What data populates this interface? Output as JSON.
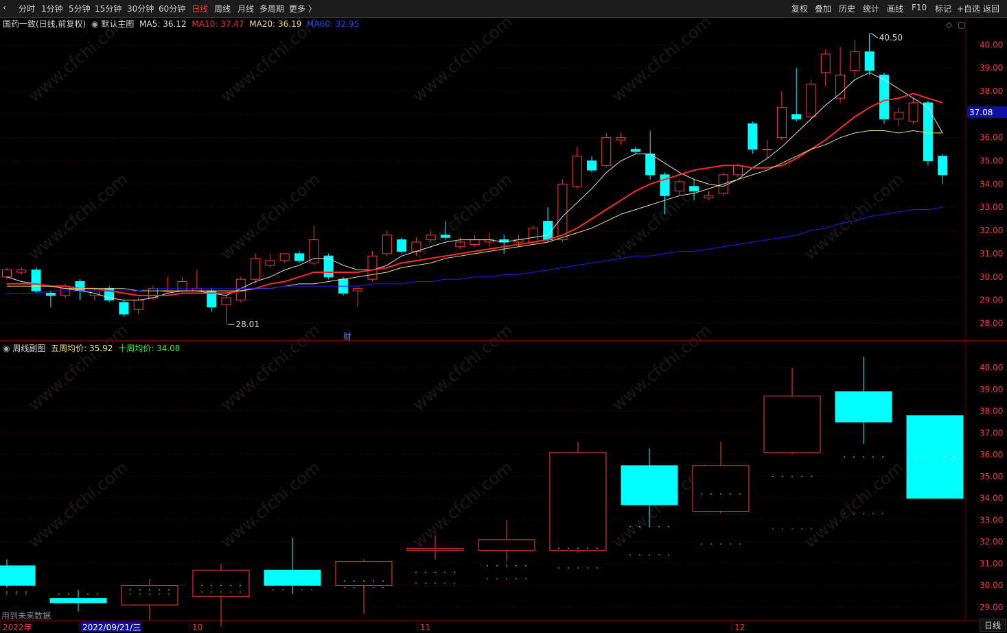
{
  "toolbar": {
    "period_tabs": [
      "分时",
      "1分钟",
      "5分钟",
      "15分钟",
      "30分钟",
      "60分钟",
      "日线",
      "周线",
      "月线",
      "多周期",
      "更多 〉"
    ],
    "active_tab": "日线",
    "right_buttons": [
      "复权",
      "叠加",
      "历史",
      "统计",
      "画线",
      "F10",
      "标记",
      "+自选",
      "返回"
    ]
  },
  "main_panel": {
    "stock": "国药一致(日线,前复权)",
    "template": "默认主图",
    "ma5_label": "MA5: 36.12",
    "ma10_label": "MA10: 37.47",
    "ma20_label": "MA20: 36.19",
    "ma60_label": "MA60: 32.95",
    "high_marker": "40.50",
    "low_marker": "28.01",
    "last_price_badge": "37.08",
    "finance_marker": "财",
    "colors": {
      "ma5": "#e0e0e0",
      "ma10": "#ff2a2a",
      "ma20": "#e8e07a",
      "ma60": "#2a2aff",
      "up": "#ff3a3a",
      "down": "#00ffff"
    }
  },
  "sub_panel": {
    "title": "周线副图",
    "ma5w_label": "五周均价: 35.92",
    "ma10w_label": "十周均价: 34.08",
    "footnote": "用到未来数据"
  },
  "x_axis": {
    "labels": [
      "2022年",
      "2022/09/21/三",
      "10",
      "11",
      "12"
    ]
  },
  "period_indicator": "日线",
  "chart_data": [
    {
      "type": "candlestick",
      "title": "国药一致(日线,前复权)",
      "ylim": [
        27.6,
        40.6
      ],
      "yticks": [
        28.0,
        29.0,
        30.0,
        31.0,
        32.0,
        33.0,
        34.0,
        35.0,
        36.0,
        37.0,
        38.0,
        39.0,
        40.0
      ],
      "candles": [
        {
          "o": 30.0,
          "c": 30.3,
          "h": 30.4,
          "l": 29.9
        },
        {
          "o": 30.2,
          "c": 30.3,
          "h": 30.4,
          "l": 30.1
        },
        {
          "o": 30.3,
          "c": 29.4,
          "h": 30.4,
          "l": 29.3
        },
        {
          "o": 29.3,
          "c": 29.2,
          "h": 29.4,
          "l": 28.7
        },
        {
          "o": 29.2,
          "c": 29.6,
          "h": 29.7,
          "l": 29.1
        },
        {
          "o": 29.8,
          "c": 29.4,
          "h": 29.9,
          "l": 29.0
        },
        {
          "o": 29.2,
          "c": 29.4,
          "h": 29.5,
          "l": 29.0
        },
        {
          "o": 29.5,
          "c": 29.0,
          "h": 29.6,
          "l": 28.9
        },
        {
          "o": 28.9,
          "c": 28.4,
          "h": 29.0,
          "l": 28.3
        },
        {
          "o": 28.6,
          "c": 29.0,
          "h": 29.1,
          "l": 28.4
        },
        {
          "o": 29.1,
          "c": 29.5,
          "h": 29.6,
          "l": 29.0
        },
        {
          "o": 29.4,
          "c": 29.4,
          "h": 30.0,
          "l": 29.3
        },
        {
          "o": 29.4,
          "c": 29.8,
          "h": 30.0,
          "l": 29.3
        },
        {
          "o": 29.4,
          "c": 29.5,
          "h": 30.3,
          "l": 29.4
        },
        {
          "o": 29.4,
          "c": 28.7,
          "h": 29.5,
          "l": 28.5
        },
        {
          "o": 28.8,
          "c": 29.1,
          "h": 29.2,
          "l": 28.0
        },
        {
          "o": 29.0,
          "c": 29.9,
          "h": 30.0,
          "l": 28.9
        },
        {
          "o": 29.9,
          "c": 30.8,
          "h": 31.0,
          "l": 29.7
        },
        {
          "o": 30.5,
          "c": 30.7,
          "h": 31.0,
          "l": 30.4
        },
        {
          "o": 30.7,
          "c": 31.0,
          "h": 31.0,
          "l": 30.6
        },
        {
          "o": 31.0,
          "c": 30.7,
          "h": 31.1,
          "l": 30.6
        },
        {
          "o": 30.6,
          "c": 31.6,
          "h": 32.2,
          "l": 30.5
        },
        {
          "o": 30.9,
          "c": 30.0,
          "h": 31.0,
          "l": 29.9
        },
        {
          "o": 29.9,
          "c": 29.3,
          "h": 30.0,
          "l": 29.2
        },
        {
          "o": 29.4,
          "c": 29.5,
          "h": 29.6,
          "l": 28.7
        },
        {
          "o": 29.9,
          "c": 30.9,
          "h": 31.1,
          "l": 29.8
        },
        {
          "o": 31.0,
          "c": 31.8,
          "h": 32.0,
          "l": 30.9
        },
        {
          "o": 31.6,
          "c": 31.1,
          "h": 31.7,
          "l": 31.0
        },
        {
          "o": 31.1,
          "c": 31.5,
          "h": 31.7,
          "l": 30.9
        },
        {
          "o": 31.6,
          "c": 31.8,
          "h": 32.0,
          "l": 31.5
        },
        {
          "o": 31.8,
          "c": 31.7,
          "h": 32.4,
          "l": 31.6
        },
        {
          "o": 31.3,
          "c": 31.5,
          "h": 31.7,
          "l": 31.2
        },
        {
          "o": 31.4,
          "c": 31.6,
          "h": 31.8,
          "l": 31.3
        },
        {
          "o": 31.5,
          "c": 31.6,
          "h": 31.9,
          "l": 31.3
        },
        {
          "o": 31.6,
          "c": 31.5,
          "h": 31.8,
          "l": 31.0
        },
        {
          "o": 31.5,
          "c": 31.6,
          "h": 31.8,
          "l": 31.3
        },
        {
          "o": 31.5,
          "c": 32.1,
          "h": 32.2,
          "l": 31.4
        },
        {
          "o": 32.4,
          "c": 31.6,
          "h": 33.0,
          "l": 31.5
        },
        {
          "o": 31.6,
          "c": 34.0,
          "h": 34.2,
          "l": 31.5
        },
        {
          "o": 33.9,
          "c": 35.2,
          "h": 35.6,
          "l": 33.8
        },
        {
          "o": 35.0,
          "c": 34.6,
          "h": 35.2,
          "l": 34.5
        },
        {
          "o": 34.8,
          "c": 36.0,
          "h": 36.2,
          "l": 34.7
        },
        {
          "o": 35.9,
          "c": 36.0,
          "h": 36.2,
          "l": 35.7
        },
        {
          "o": 35.5,
          "c": 35.4,
          "h": 35.6,
          "l": 35.3
        },
        {
          "o": 35.3,
          "c": 34.4,
          "h": 36.3,
          "l": 34.2
        },
        {
          "o": 34.4,
          "c": 33.5,
          "h": 34.5,
          "l": 32.7
        },
        {
          "o": 33.7,
          "c": 34.1,
          "h": 34.2,
          "l": 33.5
        },
        {
          "o": 33.9,
          "c": 33.7,
          "h": 34.2,
          "l": 33.3
        },
        {
          "o": 33.4,
          "c": 33.5,
          "h": 33.7,
          "l": 33.3
        },
        {
          "o": 33.6,
          "c": 34.4,
          "h": 34.5,
          "l": 33.5
        },
        {
          "o": 34.4,
          "c": 34.8,
          "h": 34.9,
          "l": 34.3
        },
        {
          "o": 36.6,
          "c": 35.5,
          "h": 36.7,
          "l": 35.3
        },
        {
          "o": 35.5,
          "c": 35.5,
          "h": 35.9,
          "l": 35.1
        },
        {
          "o": 36.0,
          "c": 37.3,
          "h": 38.0,
          "l": 35.9
        },
        {
          "o": 37.0,
          "c": 36.8,
          "h": 39.0,
          "l": 36.7
        },
        {
          "o": 36.9,
          "c": 38.3,
          "h": 38.5,
          "l": 36.8
        },
        {
          "o": 38.8,
          "c": 39.6,
          "h": 39.8,
          "l": 38.2
        },
        {
          "o": 37.7,
          "c": 38.7,
          "h": 39.9,
          "l": 37.5
        },
        {
          "o": 38.9,
          "c": 39.7,
          "h": 40.2,
          "l": 38.6
        },
        {
          "o": 39.7,
          "c": 38.9,
          "h": 40.5,
          "l": 38.7
        },
        {
          "o": 38.7,
          "c": 36.8,
          "h": 38.8,
          "l": 36.6
        },
        {
          "o": 36.8,
          "c": 37.1,
          "h": 37.3,
          "l": 36.5
        },
        {
          "o": 36.7,
          "c": 37.5,
          "h": 37.7,
          "l": 36.6
        },
        {
          "o": 37.5,
          "c": 35.0,
          "h": 37.6,
          "l": 34.8
        },
        {
          "o": 35.2,
          "c": 34.4,
          "h": 35.3,
          "l": 34.0
        }
      ],
      "series": [
        {
          "name": "MA5",
          "values": [
            30.0,
            29.8,
            29.7,
            29.6,
            29.5,
            29.4,
            29.3,
            29.1,
            29.0,
            29.0,
            29.1,
            29.3,
            29.4,
            29.4,
            29.3,
            29.2,
            29.5,
            29.8,
            30.0,
            30.3,
            30.5,
            30.8,
            30.8,
            30.5,
            30.3,
            30.3,
            30.5,
            30.9,
            31.1,
            31.3,
            31.5,
            31.6,
            31.6,
            31.6,
            31.5,
            31.6,
            31.7,
            31.8,
            32.6,
            33.2,
            33.8,
            34.5,
            35.0,
            35.3,
            35.3,
            34.9,
            34.5,
            34.2,
            34.0,
            33.9,
            34.2,
            34.7,
            35.1,
            35.6,
            36.2,
            36.8,
            37.4,
            37.9,
            38.5,
            38.8,
            38.5,
            38.1,
            37.7,
            37.3,
            36.2
          ]
        },
        {
          "name": "MA10",
          "values": [
            29.7,
            29.7,
            29.7,
            29.6,
            29.6,
            29.5,
            29.5,
            29.4,
            29.3,
            29.2,
            29.2,
            29.2,
            29.3,
            29.3,
            29.3,
            29.3,
            29.4,
            29.5,
            29.7,
            29.8,
            30.0,
            30.2,
            30.2,
            30.2,
            30.2,
            30.3,
            30.4,
            30.6,
            30.7,
            30.8,
            30.9,
            31.0,
            31.1,
            31.2,
            31.3,
            31.4,
            31.5,
            31.6,
            31.8,
            32.1,
            32.5,
            32.9,
            33.3,
            33.7,
            34.0,
            34.2,
            34.4,
            34.6,
            34.7,
            34.8,
            34.8,
            34.7,
            34.7,
            34.8,
            35.1,
            35.5,
            35.9,
            36.4,
            36.9,
            37.3,
            37.6,
            37.7,
            37.9,
            37.7,
            37.5
          ]
        },
        {
          "name": "MA20",
          "values": [
            29.6,
            29.6,
            29.6,
            29.6,
            29.5,
            29.5,
            29.5,
            29.5,
            29.5,
            29.4,
            29.4,
            29.4,
            29.4,
            29.4,
            29.4,
            29.4,
            29.4,
            29.5,
            29.5,
            29.6,
            29.7,
            29.7,
            29.8,
            29.9,
            30.0,
            30.1,
            30.2,
            30.4,
            30.5,
            30.6,
            30.8,
            30.9,
            31.0,
            31.1,
            31.2,
            31.3,
            31.4,
            31.5,
            31.7,
            31.9,
            32.1,
            32.4,
            32.7,
            32.9,
            33.1,
            33.3,
            33.5,
            33.6,
            33.8,
            34.0,
            34.2,
            34.4,
            34.6,
            34.9,
            35.2,
            35.5,
            35.7,
            36.0,
            36.2,
            36.3,
            36.3,
            36.2,
            36.3,
            36.2,
            36.2
          ]
        },
        {
          "name": "MA60",
          "values": [
            29.3,
            29.3,
            29.3,
            29.4,
            29.4,
            29.4,
            29.4,
            29.4,
            29.4,
            29.4,
            29.5,
            29.5,
            29.5,
            29.5,
            29.5,
            29.5,
            29.5,
            29.5,
            29.5,
            29.6,
            29.6,
            29.6,
            29.6,
            29.6,
            29.6,
            29.7,
            29.7,
            29.7,
            29.8,
            29.8,
            29.9,
            29.9,
            30.0,
            30.0,
            30.1,
            30.1,
            30.2,
            30.3,
            30.4,
            30.5,
            30.6,
            30.7,
            30.8,
            30.9,
            30.9,
            31.0,
            31.1,
            31.1,
            31.2,
            31.3,
            31.4,
            31.5,
            31.6,
            31.7,
            31.8,
            32.0,
            32.1,
            32.3,
            32.4,
            32.6,
            32.7,
            32.8,
            32.9,
            32.9,
            33.0
          ]
        }
      ]
    },
    {
      "type": "candlestick",
      "title": "周线副图",
      "ylim": [
        28.6,
        40.6
      ],
      "yticks": [
        29.0,
        30.0,
        31.0,
        32.0,
        33.0,
        34.0,
        35.0,
        36.0,
        37.0,
        38.0,
        39.0,
        40.0
      ],
      "candles": [
        {
          "o": 30.9,
          "c": 30.0,
          "h": 31.2,
          "l": 29.9
        },
        {
          "o": 29.4,
          "c": 29.2,
          "h": 29.8,
          "l": 28.8
        },
        {
          "o": 29.1,
          "c": 30.0,
          "h": 30.3,
          "l": 28.4
        },
        {
          "o": 29.5,
          "c": 30.7,
          "h": 31.0,
          "l": 28.1
        },
        {
          "o": 30.7,
          "c": 30.0,
          "h": 32.2,
          "l": 29.6
        },
        {
          "o": 30.0,
          "c": 31.1,
          "h": 31.2,
          "l": 28.7
        },
        {
          "o": 31.6,
          "c": 31.7,
          "h": 32.3,
          "l": 31.2
        },
        {
          "o": 31.6,
          "c": 32.1,
          "h": 33.0,
          "l": 31.1
        },
        {
          "o": 31.6,
          "c": 36.1,
          "h": 36.6,
          "l": 31.5
        },
        {
          "o": 35.5,
          "c": 33.7,
          "h": 36.3,
          "l": 32.7
        },
        {
          "o": 33.4,
          "c": 35.5,
          "h": 36.6,
          "l": 33.3
        },
        {
          "o": 36.1,
          "c": 38.7,
          "h": 40.0,
          "l": 36.0
        },
        {
          "o": 38.9,
          "c": 37.5,
          "h": 40.5,
          "l": 36.5
        },
        {
          "o": 37.8,
          "c": 34.0,
          "h": 37.8,
          "l": 34.0
        }
      ],
      "series": [
        {
          "name": "五周均价",
          "values": [
            29.7,
            29.6,
            29.8,
            30.0,
            30.0,
            30.2,
            30.6,
            30.9,
            31.7,
            32.7,
            34.2,
            35.0,
            35.9,
            35.9
          ]
        },
        {
          "name": "十周均价",
          "values": [
            29.6,
            29.6,
            29.6,
            29.7,
            29.8,
            29.9,
            30.1,
            30.3,
            30.8,
            31.4,
            31.9,
            32.6,
            33.3,
            34.1
          ]
        }
      ]
    }
  ]
}
